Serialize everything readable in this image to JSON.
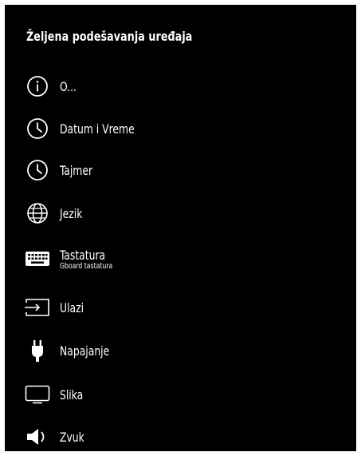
{
  "title": "Željena podešavanja uređaja",
  "colors": {
    "background": "#000000",
    "text": "#ffffff",
    "frame": "#ffffff"
  },
  "items": [
    {
      "label": "O...",
      "icon": "info-icon"
    },
    {
      "label": "Datum i Vreme",
      "icon": "clock-icon"
    },
    {
      "label": "Tajmer",
      "icon": "timer-clock-icon"
    },
    {
      "label": "Jezik",
      "icon": "globe-icon"
    },
    {
      "label": "Tastatura",
      "sublabel": "Gboard tastatura",
      "icon": "keyboard-icon"
    },
    {
      "label": "Ulazi",
      "icon": "input-icon"
    },
    {
      "label": "Napajanje",
      "icon": "power-plug-icon"
    },
    {
      "label": "Slika",
      "icon": "monitor-icon"
    },
    {
      "label": "Zvuk",
      "icon": "speaker-icon"
    }
  ]
}
